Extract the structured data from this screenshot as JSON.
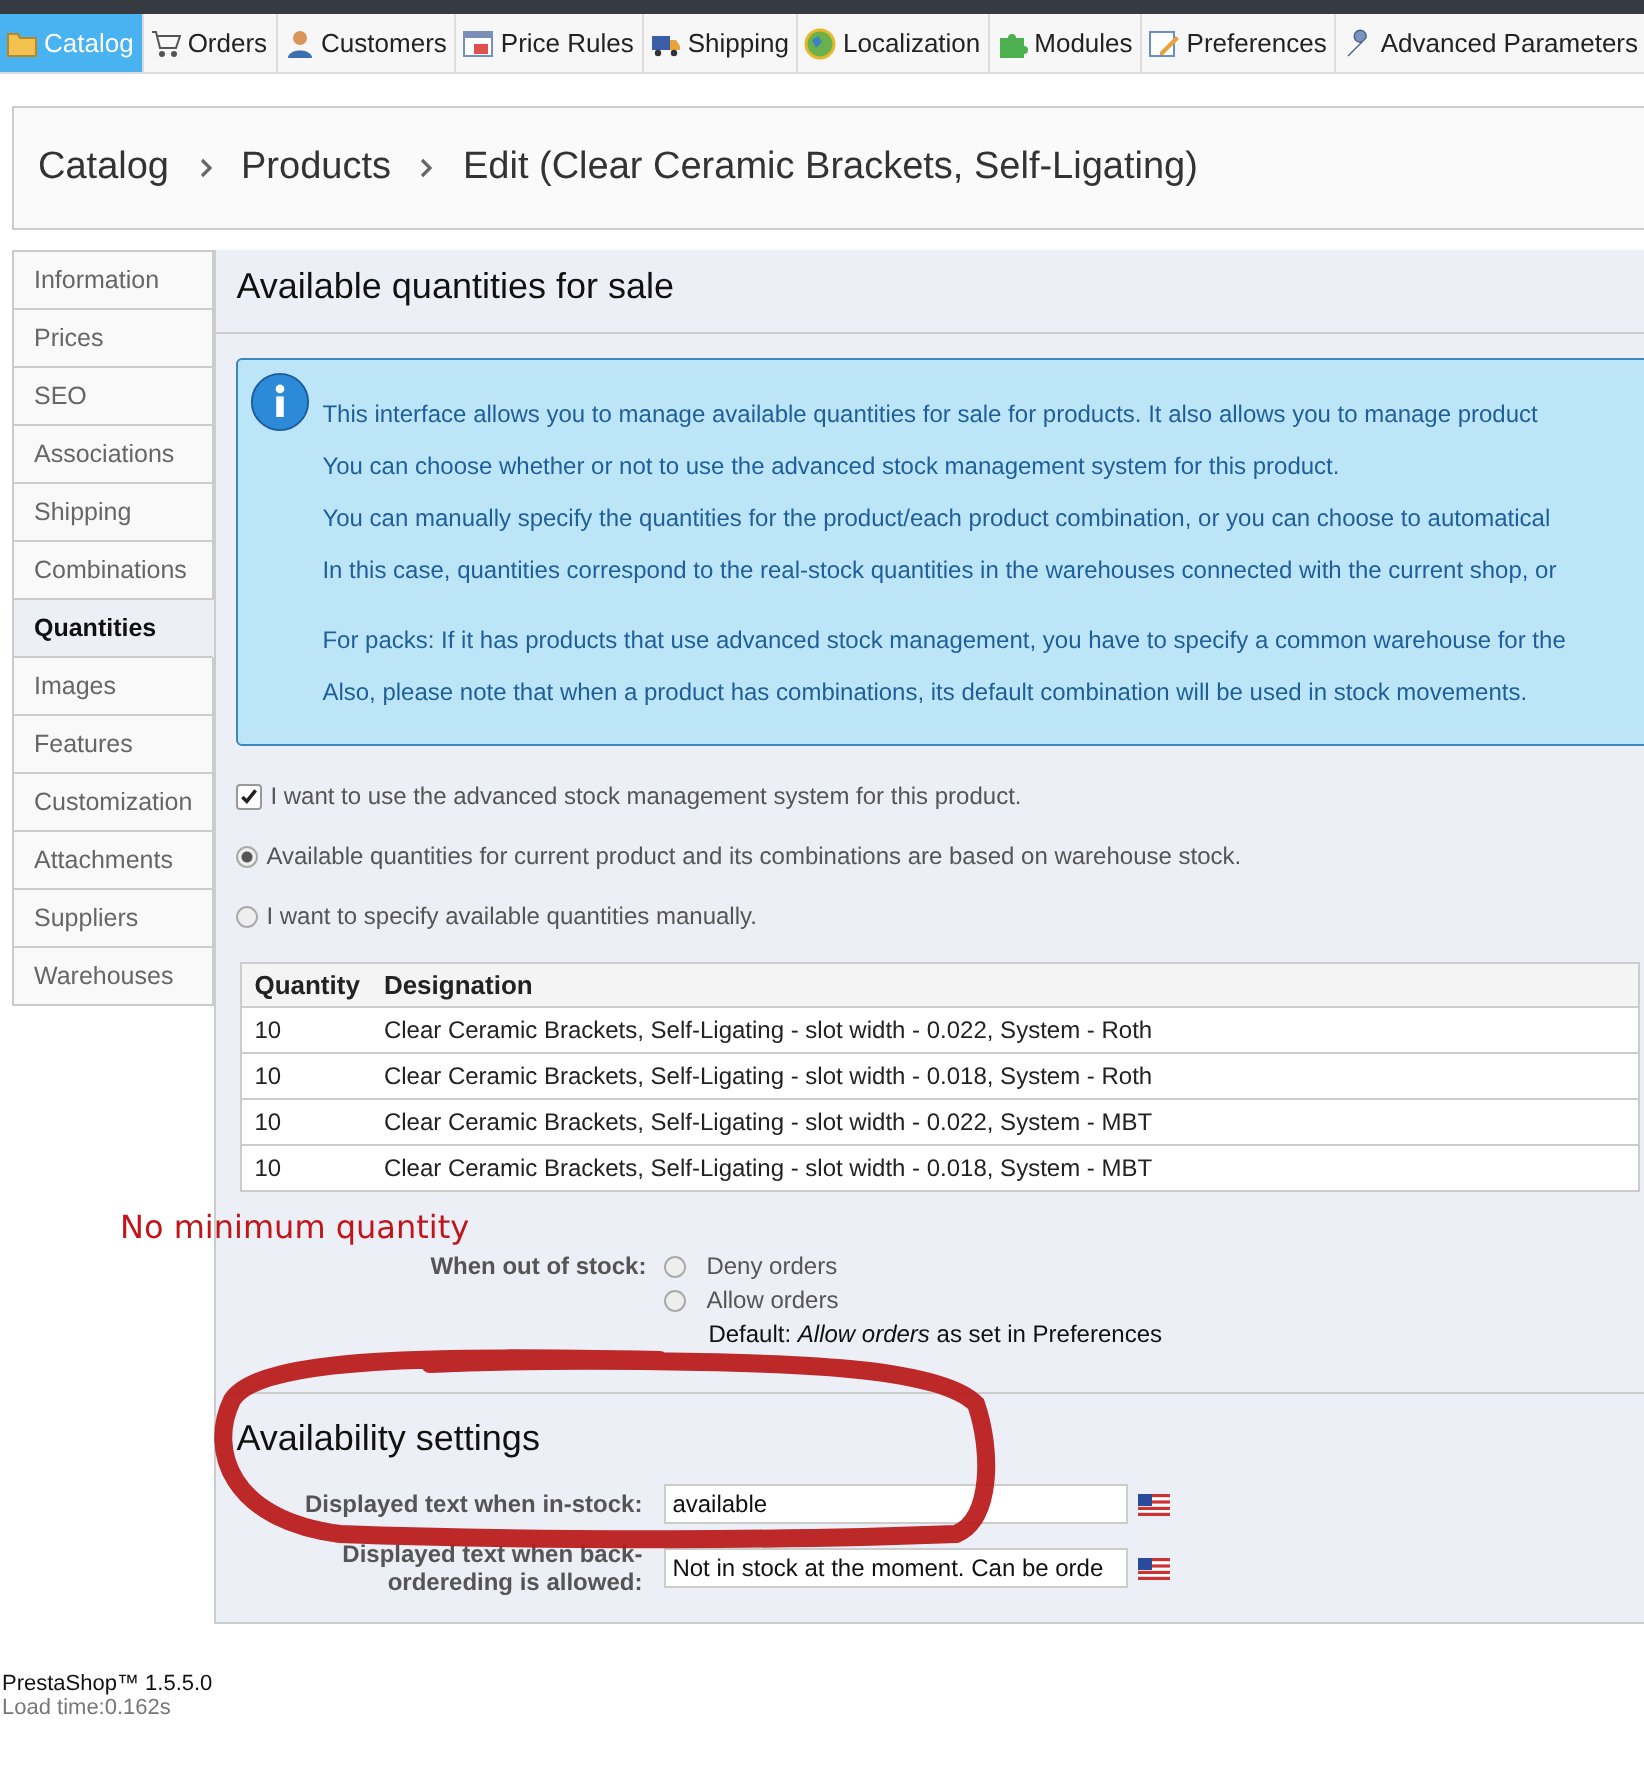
{
  "menu": {
    "tabs": [
      {
        "label": "Catalog",
        "selected": true
      },
      {
        "label": "Orders",
        "selected": false
      },
      {
        "label": "Customers",
        "selected": false
      },
      {
        "label": "Price Rules",
        "selected": false
      },
      {
        "label": "Shipping",
        "selected": false
      },
      {
        "label": "Localization",
        "selected": false
      },
      {
        "label": "Modules",
        "selected": false
      },
      {
        "label": "Preferences",
        "selected": false
      },
      {
        "label": "Advanced Parameters",
        "selected": false
      }
    ]
  },
  "breadcrumb": [
    "Catalog",
    "Products",
    "Edit (Clear Ceramic Brackets, Self-Ligating)"
  ],
  "sidebar": {
    "items": [
      {
        "label": "Information",
        "selected": false
      },
      {
        "label": "Prices",
        "selected": false
      },
      {
        "label": "SEO",
        "selected": false
      },
      {
        "label": "Associations",
        "selected": false
      },
      {
        "label": "Shipping",
        "selected": false
      },
      {
        "label": "Combinations",
        "selected": false
      },
      {
        "label": "Quantities",
        "selected": true
      },
      {
        "label": "Images",
        "selected": false
      },
      {
        "label": "Features",
        "selected": false
      },
      {
        "label": "Customization",
        "selected": false
      },
      {
        "label": "Attachments",
        "selected": false
      },
      {
        "label": "Suppliers",
        "selected": false
      },
      {
        "label": "Warehouses",
        "selected": false
      }
    ]
  },
  "quantities": {
    "title": "Available quantities for sale",
    "info": [
      [
        "This interface allows you to manage available quantities for sale for products. It also allows you to manage product",
        "You can choose whether or not to use the advanced stock management system for this product.",
        "You can manually specify the quantities for the product/each product combination, or you can choose to automatical",
        "In this case, quantities correspond to the real-stock quantities in the warehouses connected with the current shop, or"
      ],
      [
        "For packs: If it has products that use advanced stock management, you have to specify a common warehouse for the",
        "Also, please note that when a product has combinations, its default combination will be used in stock movements."
      ]
    ],
    "advanced_stock": {
      "label": "I want to use the advanced stock management system for this product.",
      "checked": true
    },
    "stock_modes": [
      {
        "label": "Available quantities for current product and its combinations are based on warehouse stock.",
        "selected": true
      },
      {
        "label": "I want to specify available quantities manually.",
        "selected": false
      }
    ],
    "table": {
      "columns": [
        "Quantity",
        "Designation"
      ],
      "rows": [
        [
          "10",
          "Clear Ceramic Brackets, Self-Ligating - slot width - 0.022, System - Roth"
        ],
        [
          "10",
          "Clear Ceramic Brackets, Self-Ligating - slot width - 0.018, System - Roth"
        ],
        [
          "10",
          "Clear Ceramic Brackets, Self-Ligating - slot width - 0.022, System - MBT"
        ],
        [
          "10",
          "Clear Ceramic Brackets, Self-Ligating - slot width - 0.018, System - MBT"
        ]
      ]
    }
  },
  "annotation": {
    "text": "No minimum quantity"
  },
  "out_of_stock": {
    "label": "When out of stock:",
    "options": [
      {
        "label": "Deny orders",
        "selected": false
      },
      {
        "label": "Allow orders",
        "selected": false
      }
    ],
    "default_note": "Default: *Allow orders* as set in Preferences"
  },
  "availability": {
    "title": "Availability settings",
    "fields": [
      {
        "label": "Displayed text when in-stock:",
        "value": "available"
      },
      {
        "label": "Displayed text when back-ordereding is allowed:",
        "value": "Not in stock at the moment. Can be orde"
      }
    ]
  },
  "footer": {
    "version": "PrestaShop™ 1.5.5.0",
    "load_time": "Load time:0.162s"
  }
}
